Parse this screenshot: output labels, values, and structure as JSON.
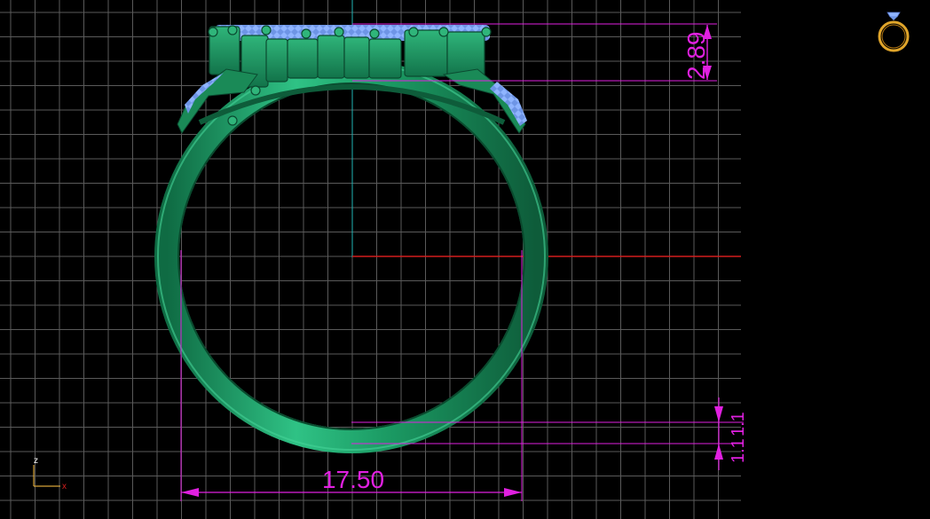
{
  "viewport": {
    "view": "front",
    "background_color": "#000000",
    "grid_color": "#5a5a5a",
    "axis_vertical_color": "#1fb3b3",
    "axis_horizontal_color": "#d21e1e",
    "dimension_color": "#e020e0",
    "ring_color": "#1e9a62",
    "stone_color": "#8fb4ff"
  },
  "dimensions": {
    "inner_diameter": "17.50",
    "top_height": "2.89",
    "band_thickness_1": "1.1",
    "band_thickness_2": "1.1"
  },
  "axes": {
    "z_label": "z",
    "x_label": "x"
  },
  "widgets": {
    "preview_icon": "ring-preview-icon"
  }
}
